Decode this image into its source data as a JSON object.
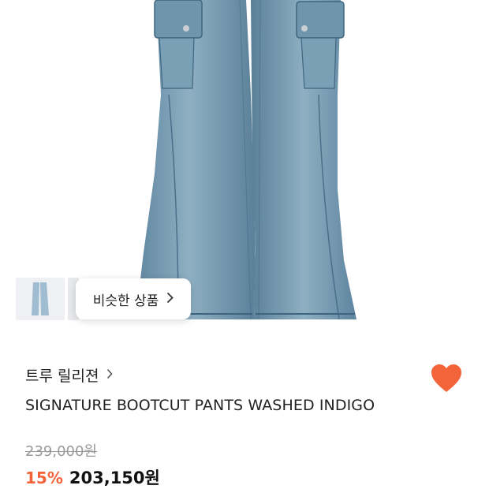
{
  "product": {
    "similar_label": "비슷한 상품",
    "brand": "트루 릴리젼",
    "name": "SIGNATURE BOOTCUT PANTS WASHED INDIGO",
    "original_price": "239,000원",
    "discount": "15%",
    "sale_price": "203,150원",
    "liked": true
  },
  "icons": {
    "similar_chevron": "chevron-right-icon",
    "brand_chevron": "chevron-right-icon",
    "like": "heart-icon"
  },
  "colors": {
    "accent": "#f4643a",
    "denim": "#6f95ad"
  }
}
